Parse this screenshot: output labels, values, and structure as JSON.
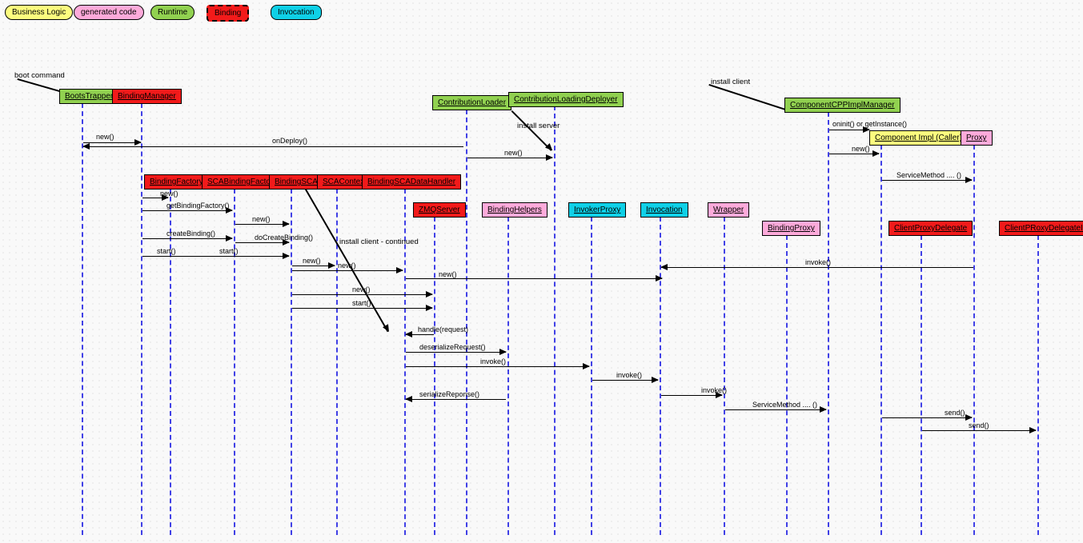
{
  "legend": {
    "business": "Business Logic",
    "generated": "generated code",
    "runtime": "Runtime",
    "binding": "Binding",
    "invocation": "Invocation"
  },
  "participants": {
    "boot": "BootsTrapper",
    "bindmgr": "BindingManager",
    "bindfact": "BindingFactory",
    "scabindfact": "SCABindingFactory",
    "bindsca": "BindingSCA",
    "scactx": "SCAContext",
    "scadatah": "BindingSCADataHandler",
    "zmq": "ZMQServer",
    "contribload": "ContributionLoader",
    "contribdeploy": "ContributionLoadingDeployer",
    "bindhelp": "BindingHelpers",
    "invproxy": "InvokerProxy",
    "invocation": "Invocation",
    "wrapper": "Wrapper",
    "bindproxy": "BindingProxy",
    "cppmgr": "ComponentCPPImplManager",
    "compimpl": "Component Impl (Caller)",
    "clientpd": "ClientProxyDelegate",
    "proxy": "Proxy",
    "clientpdimpl": "ClientPRoxyDelegateImpl"
  },
  "labels": {
    "bootcmd": "boot command",
    "installclient": "install client",
    "installserver": "install server",
    "installclientcont": "install client - continued",
    "oninit": "oninit() or getInstance()",
    "servicemethod": "ServiceMethod .... ()",
    "servicemethod2": "ServiceMethod .... ()"
  },
  "messages": {
    "new": "new()",
    "ondeploy": "onDeploy()",
    "getbindfact": "getBindingFactory()",
    "createbind": "createBinding()",
    "docreatebind": "doCreateBinding()",
    "start": "start()",
    "handle": "handle(request)",
    "deserialize": "deserializeRequest()",
    "invoke": "invoke()",
    "serialize": "serializeReponse()",
    "send": "send()"
  }
}
